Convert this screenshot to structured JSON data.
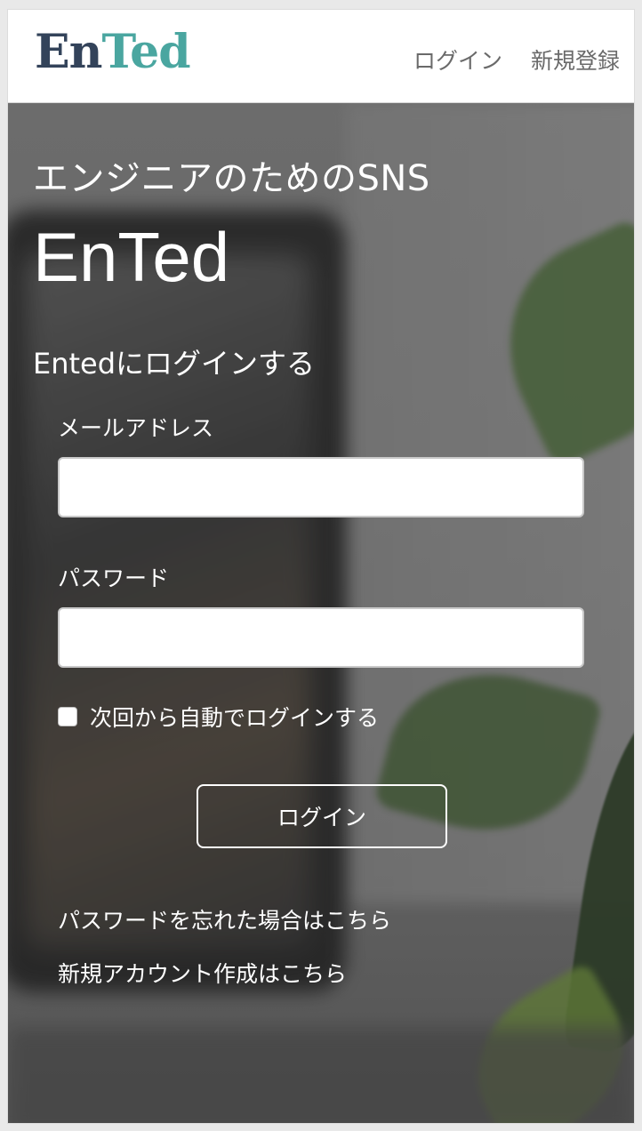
{
  "header": {
    "logo_part1": "En",
    "logo_part2": "Ted",
    "nav_login": "ログイン",
    "nav_signup": "新規登録"
  },
  "hero": {
    "tagline": "エンジニアのためのSNS",
    "brand": "EnTed"
  },
  "form": {
    "title": "Entedにログインする",
    "email_label": "メールアドレス",
    "email_value": "",
    "password_label": "パスワード",
    "password_value": "",
    "remember_label": "次回から自動でログインする",
    "remember_checked": false,
    "submit_label": "ログイン"
  },
  "links": {
    "forgot_password": "パスワードを忘れた場合はこちら",
    "create_account": "新規アカウント作成はこちら"
  },
  "colors": {
    "logo_dark": "#33435a",
    "logo_accent": "#4aa6a0",
    "nav_text": "#6a6a6a"
  }
}
